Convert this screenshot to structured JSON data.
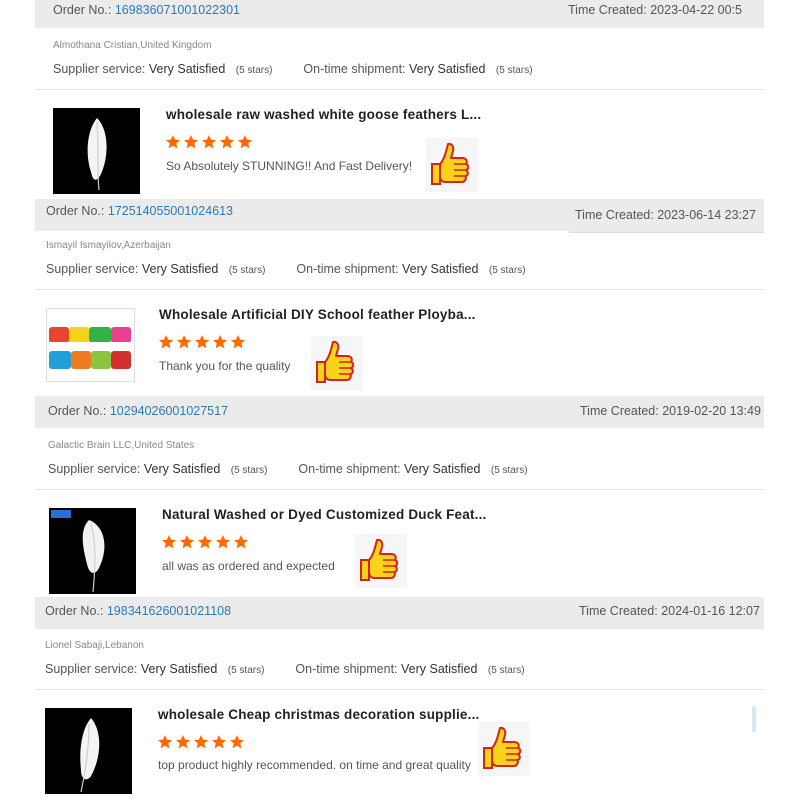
{
  "labels": {
    "order_no": "Order No.:",
    "time_created": "Time Created:",
    "supplier_service": "Supplier service:",
    "ontime_shipment": "On-time shipment:",
    "rating_value": "Very Satisfied",
    "stars_text": "(5 stars)"
  },
  "reviews": [
    {
      "order_no": "169836071001022301",
      "time_created": "2023-04-22 00:5",
      "buyer": "Almothana Cristian,United Kingdom",
      "supplier_service": "Very Satisfied",
      "supplier_stars": "(5 stars)",
      "shipment": "Very Satisfied",
      "shipment_stars": "(5 stars)",
      "product_title": "wholesale raw washed white goose feathers L...",
      "rating": 5,
      "comment": "So Absolutely STUNNING!! And Fast Delivery!",
      "thumb_icon": "white-feather-on-black-image"
    },
    {
      "order_no": "172514055001024613",
      "time_created": "2023-06-14 23:27",
      "buyer": "Ismayil Ismayilov,Azerbaijan",
      "supplier_service": "Very Satisfied",
      "supplier_stars": "(5 stars)",
      "shipment": "Very Satisfied",
      "shipment_stars": "(5 stars)",
      "product_title": "Wholesale Artificial DIY School feather Ploybа...",
      "rating": 5,
      "comment": "Thank you for the quality",
      "thumb_icon": "colorful-feathers-image"
    },
    {
      "order_no": "10294026001027517",
      "time_created": "2019-02-20 13:49",
      "buyer": "Galactic Brain LLC,United States",
      "supplier_service": "Very Satisfied",
      "supplier_stars": "(5 stars)",
      "shipment": "Very Satisfied",
      "shipment_stars": "(5 stars)",
      "product_title": "Natural Washed or Dyed Customized Duck Feat...",
      "rating": 5,
      "comment": "all was as ordered and expected",
      "thumb_icon": "white-feather-on-black-image"
    },
    {
      "order_no": "198341626001021108",
      "time_created": "2024-01-16 12:07",
      "buyer": "Lionel Sabaji,Lebanon",
      "supplier_service": "Very Satisfied",
      "supplier_stars": "(5 stars)",
      "shipment": "Very Satisfied",
      "shipment_stars": "(5 stars)",
      "product_title": "wholesale Cheap christmas decoration supplie...",
      "rating": 5,
      "comment": "top product highly recommended. on time and great quality",
      "thumb_icon": "white-feather-on-black-image"
    }
  ],
  "colors": {
    "order_link": "#2a7ab8",
    "star": "#ff6a00",
    "bar_bg": "#ebebeb"
  }
}
